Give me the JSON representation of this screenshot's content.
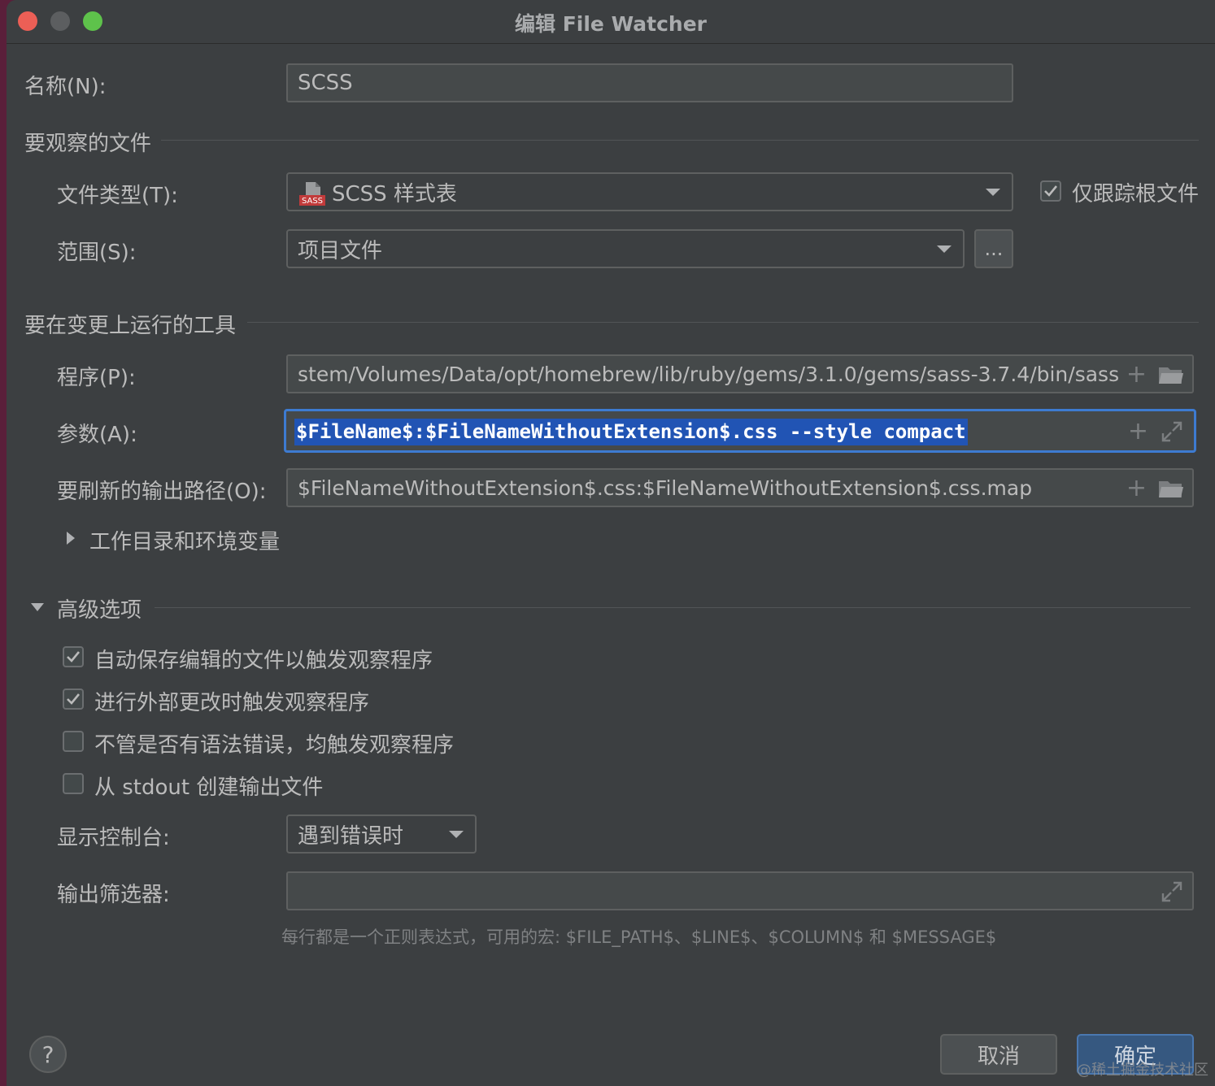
{
  "window": {
    "title": "编辑 File Watcher"
  },
  "name": {
    "label": "名称(N):",
    "value": "SCSS"
  },
  "watch_section": {
    "title": "要观察的文件"
  },
  "file_type": {
    "label": "文件类型(T):",
    "value": "SCSS 样式表",
    "icon_text": "SASS"
  },
  "root_only": {
    "label": "仅跟踪根文件",
    "checked": true
  },
  "scope": {
    "label": "范围(S):",
    "value": "项目文件",
    "more_button": "..."
  },
  "tool_section": {
    "title": "要在变更上运行的工具"
  },
  "program": {
    "label": "程序(P):",
    "value": "stem/Volumes/Data/opt/homebrew/lib/ruby/gems/3.1.0/gems/sass-3.7.4/bin/sass"
  },
  "arguments": {
    "label": "参数(A):",
    "value": "$FileName$:$FileNameWithoutExtension$.css --style compact"
  },
  "output_paths": {
    "label": "要刷新的输出路径(O):",
    "value": "$FileNameWithoutExtension$.css:$FileNameWithoutExtension$.css.map"
  },
  "workdir": {
    "label": "工作目录和环境变量"
  },
  "advanced": {
    "title": "高级选项",
    "options": [
      {
        "label": "自动保存编辑的文件以触发观察程序",
        "checked": true
      },
      {
        "label": "进行外部更改时触发观察程序",
        "checked": true
      },
      {
        "label": "不管是否有语法错误，均触发观察程序",
        "checked": false
      },
      {
        "label": "从 stdout 创建输出文件",
        "checked": false
      }
    ]
  },
  "console": {
    "label": "显示控制台:",
    "value": "遇到错误时"
  },
  "output_filter": {
    "label": "输出筛选器:",
    "value": "",
    "hint": "每行都是一个正则表达式，可用的宏: $FILE_PATH$、$LINE$、$COLUMN$ 和 $MESSAGE$"
  },
  "buttons": {
    "cancel": "取消",
    "ok": "确定",
    "help": "?"
  },
  "watermark": "@稀土掘金技术社区",
  "colors": {
    "accent": "#3d7bd1",
    "selection": "#2154b4",
    "background": "#3c3f41",
    "ok_button": "#365880"
  }
}
